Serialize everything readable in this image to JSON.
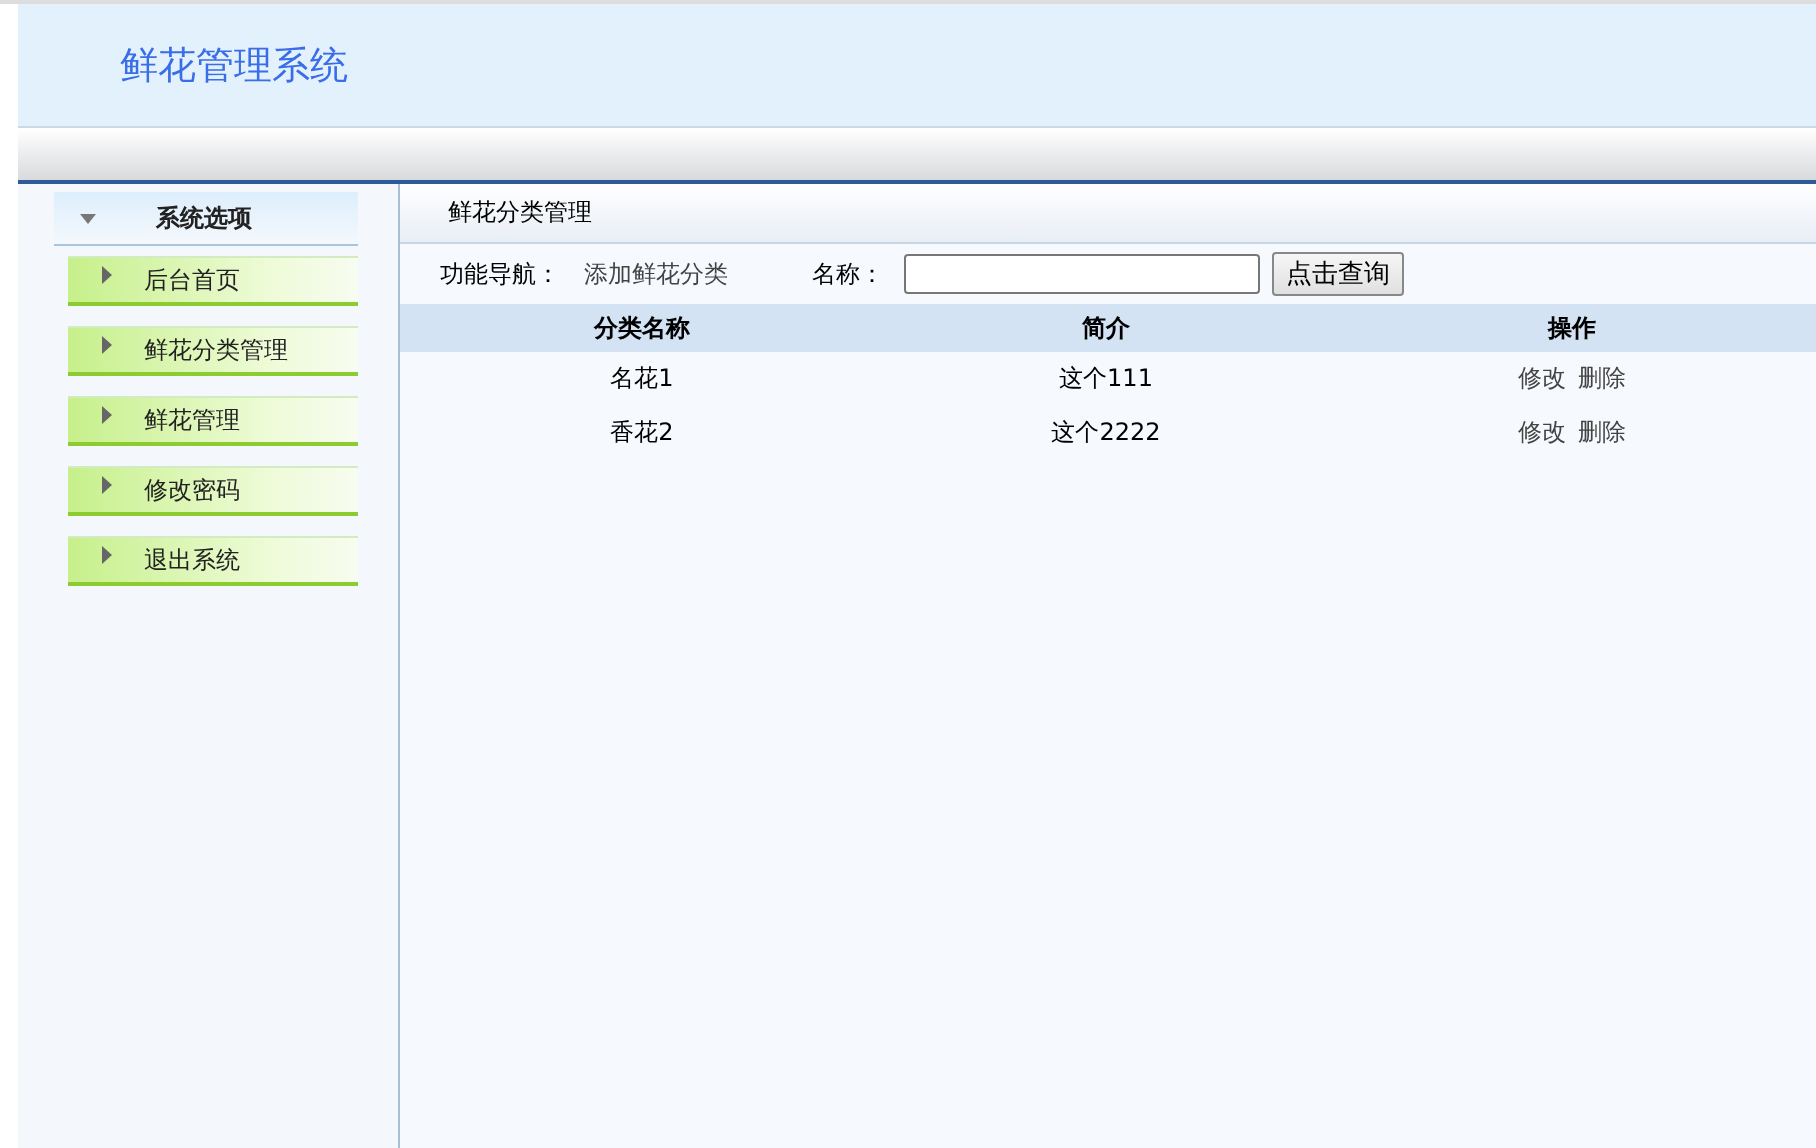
{
  "header": {
    "title": "鲜花管理系统"
  },
  "sidebar": {
    "title": "系统选项",
    "items": [
      {
        "label": "后台首页"
      },
      {
        "label": "鲜花分类管理"
      },
      {
        "label": "鲜花管理"
      },
      {
        "label": "修改密码"
      },
      {
        "label": "退出系统"
      }
    ]
  },
  "content": {
    "title": "鲜花分类管理",
    "nav_label": "功能导航：",
    "nav_link": "添加鲜花分类",
    "search_label": "名称：",
    "search_button": "点击查询",
    "table": {
      "columns": [
        "分类名称",
        "简介",
        "操作"
      ],
      "rows": [
        {
          "name": "名花1",
          "intro": "这个111",
          "actions": [
            "修改",
            "删除"
          ]
        },
        {
          "name": "香花2",
          "intro": "这个2222",
          "actions": [
            "修改",
            "删除"
          ]
        }
      ]
    }
  }
}
